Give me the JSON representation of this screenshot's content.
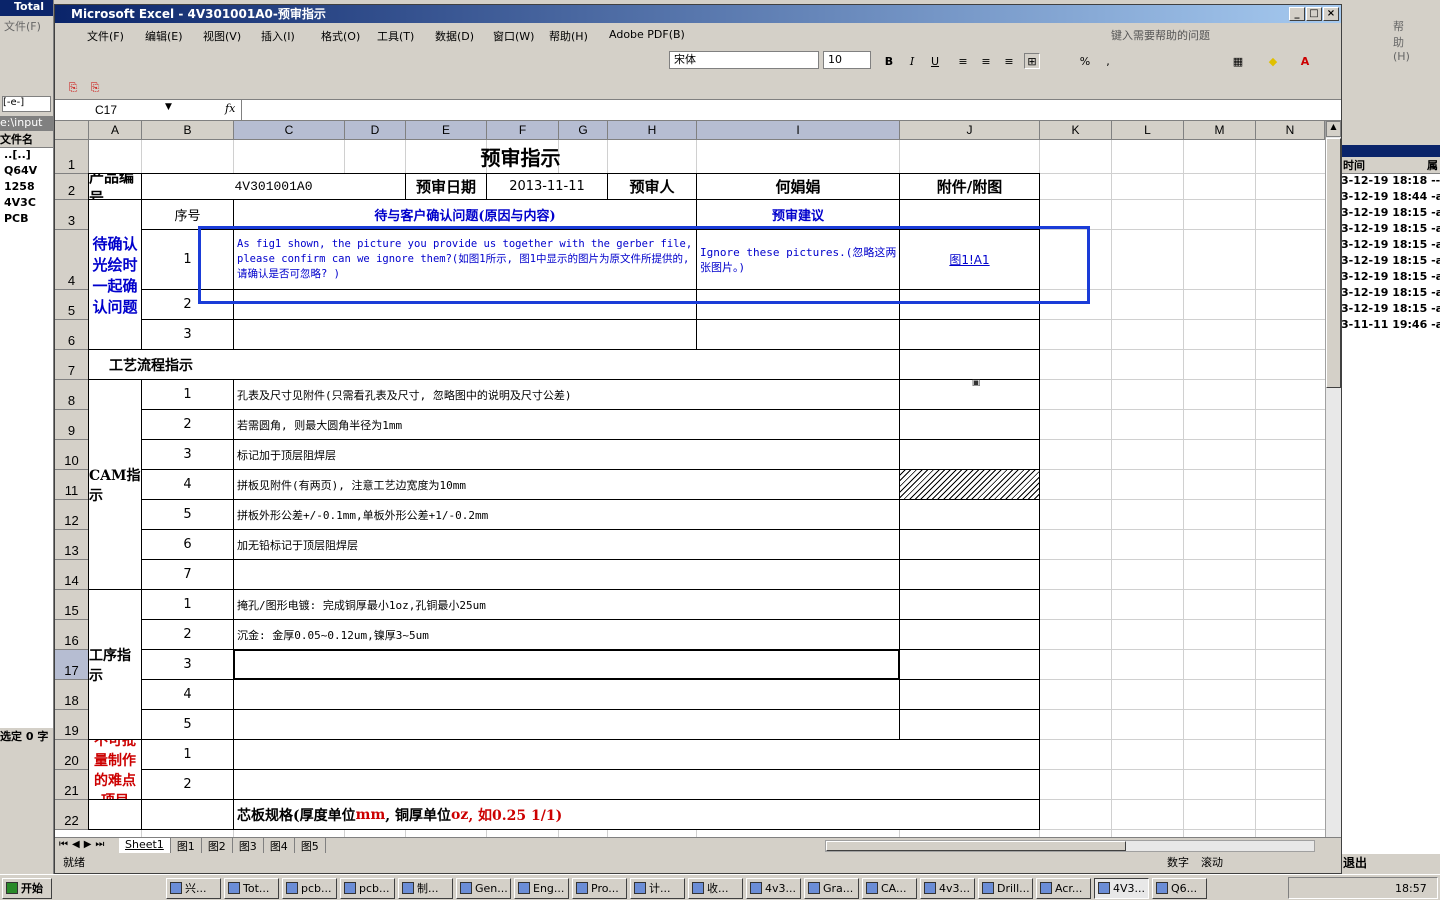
{
  "left_panel": {
    "title": "Total",
    "menu": "文件(F)",
    "drive": "[-e-]",
    "path": "e:\\input",
    "col_header": "文件名",
    "files": [
      "..[..]",
      "Q64V",
      "1258",
      "4V3C",
      "PCB"
    ],
    "status": "选定 0 字"
  },
  "right_panel": {
    "help": "帮助(H)",
    "col_header": "时间",
    "col_header2": "属",
    "times": [
      "3-12-19 18:18 ----",
      "3-12-19 18:44 -a-",
      "3-12-19 18:15 -a-",
      "3-12-19 18:15 -a-",
      "3-12-19 18:15 -a-",
      "3-12-19 18:15 -a-",
      "3-12-19 18:15 -a-",
      "3-12-19 18:15 -a-",
      "3-12-19 18:15 -a-",
      "3-11-11 19:46 -a-"
    ],
    "exit": "退出"
  },
  "window": {
    "title": "Microsoft Excel - 4V301001A0-预审指示"
  },
  "menu": [
    "文件(F)",
    "编辑(E)",
    "视图(V)",
    "插入(I)",
    "格式(O)",
    "工具(T)",
    "数据(D)",
    "窗口(W)",
    "帮助(H)",
    "Adobe PDF(B)"
  ],
  "help_placeholder": "键入需要帮助的问题",
  "font_name": "宋体",
  "font_size": "10",
  "name_box": "C17",
  "fx": "fx",
  "columns": [
    "A",
    "B",
    "C",
    "D",
    "E",
    "F",
    "G",
    "H",
    "I",
    "J",
    "K",
    "L",
    "M",
    "N"
  ],
  "rows": [
    "1",
    "2",
    "3",
    "4",
    "5",
    "6",
    "7",
    "8",
    "9",
    "10",
    "11",
    "12",
    "13",
    "14",
    "15",
    "16",
    "17",
    "18",
    "19",
    "20",
    "21",
    "22"
  ],
  "sheet": {
    "title": "预审指示",
    "r2": {
      "product_label": "产品编号",
      "product": "4V301001A0",
      "date_label": "预审日期",
      "date": "2013-11-11",
      "reviewer_label": "预审人",
      "reviewer": "何娟娟",
      "attach_label": "附件/附图"
    },
    "r3": {
      "seq": "序号",
      "issue": "待与客户确认问题(原因与内容)",
      "suggest": "预审建议"
    },
    "confirm_label": "待确认光绘时一起确认问题",
    "q1": {
      "n": "1",
      "text": "As fig1 shown, the picture you provide us together with the gerber file, please confirm can we ignore them?(如图1所示, 图1中显示的图片为原文件所提供的, 请确认是否可忽略? )",
      "suggest": "Ignore these pictures.(忽略这两张图片。)",
      "link": "图1!A1"
    },
    "q2": "2",
    "q3": "3",
    "process_label": "工艺流程指示",
    "cam_label": "CAM指示",
    "cam": [
      [
        "1",
        "孔表及尺寸见附件(只需看孔表及尺寸, 忽略图中的说明及尺寸公差)"
      ],
      [
        "2",
        "若需圆角, 则最大圆角半径为1mm"
      ],
      [
        "3",
        "标记加于顶层阻焊层"
      ],
      [
        "4",
        "拼板见附件(有两页), 注意工艺边宽度为10mm"
      ],
      [
        "5",
        "拼板外形公差+/-0.1mm,单板外形公差+1/-0.2mm"
      ],
      [
        "6",
        "加无铅标记于顶层阻焊层"
      ],
      [
        "7",
        ""
      ]
    ],
    "proc_label": "工序指示",
    "proc": [
      [
        "1",
        "掩孔/图形电镀: 完成铜厚最小1oz,孔铜最小25um"
      ],
      [
        "2",
        "沉金: 金厚0.05~0.12um,镍厚3~5um"
      ],
      [
        "3",
        ""
      ],
      [
        "4",
        ""
      ],
      [
        "5",
        ""
      ]
    ],
    "diff_label": "不可批量制作的难点项目",
    "diff": [
      "1",
      "2"
    ],
    "core": {
      "a": "芯板规格(厚度单位",
      "b": "mm",
      "c": ", 铜厚单位",
      "d": "oz",
      "e": ", 如0.25 1/1)"
    }
  },
  "tabs": [
    "Sheet1",
    "图1",
    "图2",
    "图3",
    "图4",
    "图5"
  ],
  "status": {
    "ready": "就绪",
    "num": "数字",
    "scroll": "滚动"
  },
  "taskbar": {
    "start": "开始",
    "clock": "18:57",
    "tasks": [
      "兴...",
      "Tot...",
      "pcb...",
      "pcb...",
      "制...",
      "Gen...",
      "Eng...",
      "Pro...",
      "计...",
      "收...",
      "4v3...",
      "Gra...",
      "CA...",
      "4v3...",
      "Drill...",
      "Acr...",
      "4V3...",
      "Q6..."
    ]
  }
}
